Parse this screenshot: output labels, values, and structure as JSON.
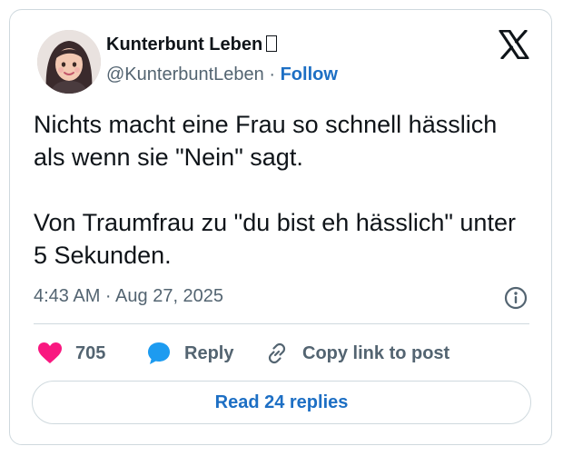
{
  "author": {
    "name": "Kunterbunt Leben",
    "handle": "@KunterbuntLeben",
    "separator": "·",
    "follow_label": "Follow"
  },
  "tweet": {
    "paragraphs": [
      "Nichts macht eine Frau so schnell hässlich als wenn sie \"Nein\" sagt.",
      "Von Traumfrau zu \"du bist eh hässlich\" unter 5 Sekunden."
    ],
    "timestamp": "4:43 AM · Aug 27, 2025"
  },
  "actions": {
    "likes_count": "705",
    "reply_label": "Reply",
    "copy_link_label": "Copy link to post"
  },
  "read_replies_label": "Read 24 replies",
  "icons": {
    "brand": "x-logo-icon",
    "like": "heart-icon",
    "reply": "speech-bubble-icon",
    "copy": "link-icon",
    "info": "info-icon"
  },
  "colors": {
    "heart": "#f91880",
    "reply_bubble": "#1d9bf0",
    "link": "#1d6fc4",
    "text": "#0f1419",
    "muted": "#536471",
    "border": "#cfd9de"
  }
}
